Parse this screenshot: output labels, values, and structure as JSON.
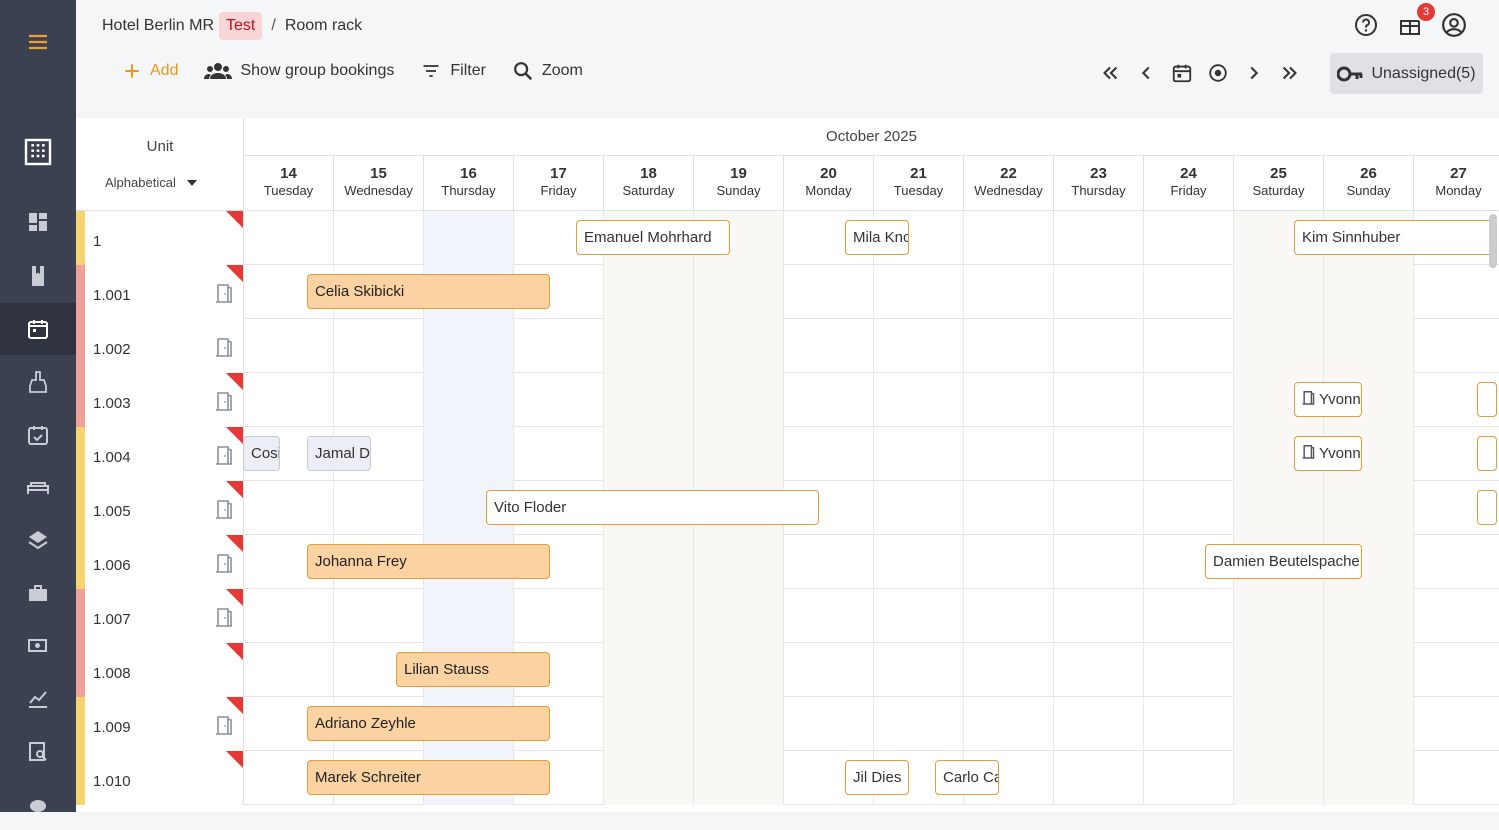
{
  "header": {
    "property": "Hotel Berlin MR",
    "env_tag": "Test",
    "separator": "/",
    "page": "Room rack",
    "notifications_count": "3"
  },
  "toolbar": {
    "add": "Add",
    "group": "Show group bookings",
    "filter": "Filter",
    "zoom": "Zoom",
    "unassigned": "Unassigned(5)"
  },
  "grid": {
    "unit_header": "Unit",
    "sort": "Alphabetical",
    "month": "October 2025",
    "days": [
      {
        "n": "14",
        "w": "Tuesday"
      },
      {
        "n": "15",
        "w": "Wednesday"
      },
      {
        "n": "16",
        "w": "Thursday"
      },
      {
        "n": "17",
        "w": "Friday"
      },
      {
        "n": "18",
        "w": "Saturday"
      },
      {
        "n": "19",
        "w": "Sunday"
      },
      {
        "n": "20",
        "w": "Monday"
      },
      {
        "n": "21",
        "w": "Tuesday"
      },
      {
        "n": "22",
        "w": "Wednesday"
      },
      {
        "n": "23",
        "w": "Thursday"
      },
      {
        "n": "24",
        "w": "Friday"
      },
      {
        "n": "25",
        "w": "Saturday"
      },
      {
        "n": "26",
        "w": "Sunday"
      },
      {
        "n": "27",
        "w": "Monday"
      }
    ],
    "rows": [
      {
        "unit": "1"
      },
      {
        "unit": "1.001"
      },
      {
        "unit": "1.002"
      },
      {
        "unit": "1.003"
      },
      {
        "unit": "1.004"
      },
      {
        "unit": "1.005"
      },
      {
        "unit": "1.006"
      },
      {
        "unit": "1.007"
      },
      {
        "unit": "1.008"
      },
      {
        "unit": "1.009"
      },
      {
        "unit": "1.010"
      }
    ],
    "bookings": {
      "r0a": "Emanuel Mohrhard",
      "r0b": "Mila Knc",
      "r0c": "Kim Sinnhuber",
      "r1a": "Celia Skibicki",
      "r3a": "Yvonn",
      "r4a": "Cosi",
      "r4b": "Jamal D",
      "r4c": "Yvonn",
      "r5a": "Vito Floder",
      "r6a": "Johanna Frey",
      "r6b": "Damien Beutelspache",
      "r8a": "Lilian Stauss",
      "r9a": "Adriano Zeyhle",
      "r10a": "Marek Schreiter",
      "r10b": "Jil Dies",
      "r10c": "Carlo Ca"
    }
  }
}
